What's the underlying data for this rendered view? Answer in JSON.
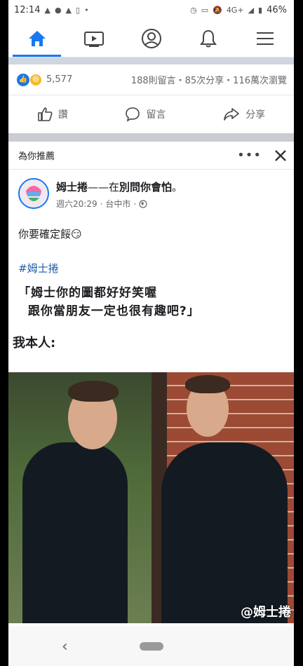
{
  "status_bar": {
    "time": "12:14",
    "network": "4G+",
    "battery": "46%"
  },
  "nav": {
    "items": [
      {
        "icon": "home-icon",
        "active": true
      },
      {
        "icon": "video-icon",
        "active": false
      },
      {
        "icon": "profile-icon",
        "active": false
      },
      {
        "icon": "bell-icon",
        "active": false
      },
      {
        "icon": "menu-icon",
        "active": false
      }
    ]
  },
  "reactions": {
    "count": "5,577",
    "stats": "188則留言・85次分享・116萬次瀏覽"
  },
  "actions": {
    "like": "讚",
    "comment": "留言",
    "share": "分享"
  },
  "recommendation": {
    "label": "為你推薦"
  },
  "post": {
    "author": "姆士捲",
    "separator": "——在",
    "activity": "別問你會怕",
    "period": "。",
    "date": "週六20:29",
    "location": "台中市",
    "text": "你要確定餒😏",
    "hashtag": "#姆士捲",
    "quote_line1": "「姆士你的圖都好好笑喔",
    "quote_line2": "  跟你當朋友一定也很有趣吧?」",
    "caption": "我本人:",
    "watermark": "@姆士捲"
  },
  "colors": {
    "accent": "#1877f2",
    "hashtag": "#1b5ea9",
    "muted": "#65676b"
  }
}
